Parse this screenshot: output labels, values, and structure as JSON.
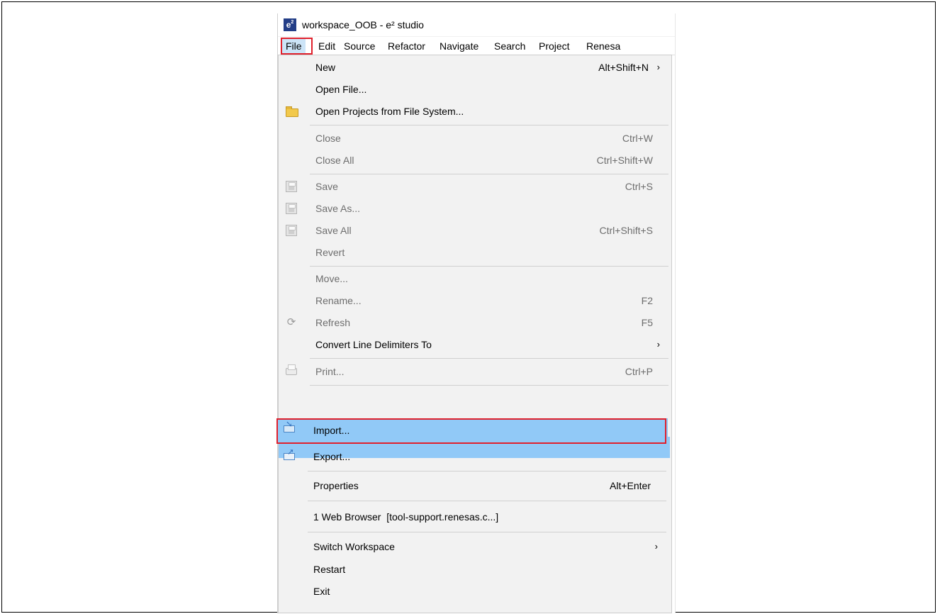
{
  "window": {
    "app_logo_text": "e",
    "app_logo_superscript": "2",
    "title": "workspace_OOB - e² studio"
  },
  "menubar": {
    "items": [
      "File",
      "Edit",
      "Source",
      "Refactor",
      "Navigate",
      "Search",
      "Project",
      "Renesa"
    ]
  },
  "file_menu": {
    "items": [
      {
        "label": "New",
        "shortcut": "Alt+Shift+N",
        "submenu": true,
        "enabled": true
      },
      {
        "label": "Open File...",
        "enabled": true
      },
      {
        "label": "Open Projects from File System...",
        "icon": "folder-icon",
        "enabled": true
      },
      {
        "label": "Close",
        "shortcut": "Ctrl+W",
        "enabled": false
      },
      {
        "label": "Close All",
        "shortcut": "Ctrl+Shift+W",
        "enabled": false
      },
      {
        "label": "Save",
        "shortcut": "Ctrl+S",
        "icon": "save-icon",
        "enabled": false
      },
      {
        "label": "Save As...",
        "icon": "save-as-icon",
        "enabled": false
      },
      {
        "label": "Save All",
        "shortcut": "Ctrl+Shift+S",
        "icon": "save-all-icon",
        "enabled": false
      },
      {
        "label": "Revert",
        "enabled": false
      },
      {
        "label": "Move...",
        "enabled": false
      },
      {
        "label": "Rename...",
        "shortcut": "F2",
        "enabled": false
      },
      {
        "label": "Refresh",
        "shortcut": "F5",
        "icon": "refresh-icon",
        "enabled": false
      },
      {
        "label": "Convert Line Delimiters To",
        "submenu": true,
        "enabled": true
      },
      {
        "label": "Print...",
        "shortcut": "Ctrl+P",
        "icon": "print-icon",
        "enabled": false
      },
      {
        "label": "Import...",
        "icon": "import-icon",
        "enabled": true,
        "highlighted": true
      },
      {
        "label": "Export...",
        "icon": "export-icon",
        "enabled": true
      },
      {
        "label": "Properties",
        "shortcut": "Alt+Enter",
        "enabled": true
      },
      {
        "label": "1 Web Browser  [tool-support.renesas.c...]",
        "enabled": true
      },
      {
        "label": "Switch Workspace",
        "submenu": true,
        "enabled": true
      },
      {
        "label": "Restart",
        "enabled": true
      },
      {
        "label": "Exit",
        "enabled": true
      }
    ],
    "submenu_arrow": "›"
  },
  "colors": {
    "highlight": "#91c9f7",
    "annotation_box": "#e0202c"
  }
}
